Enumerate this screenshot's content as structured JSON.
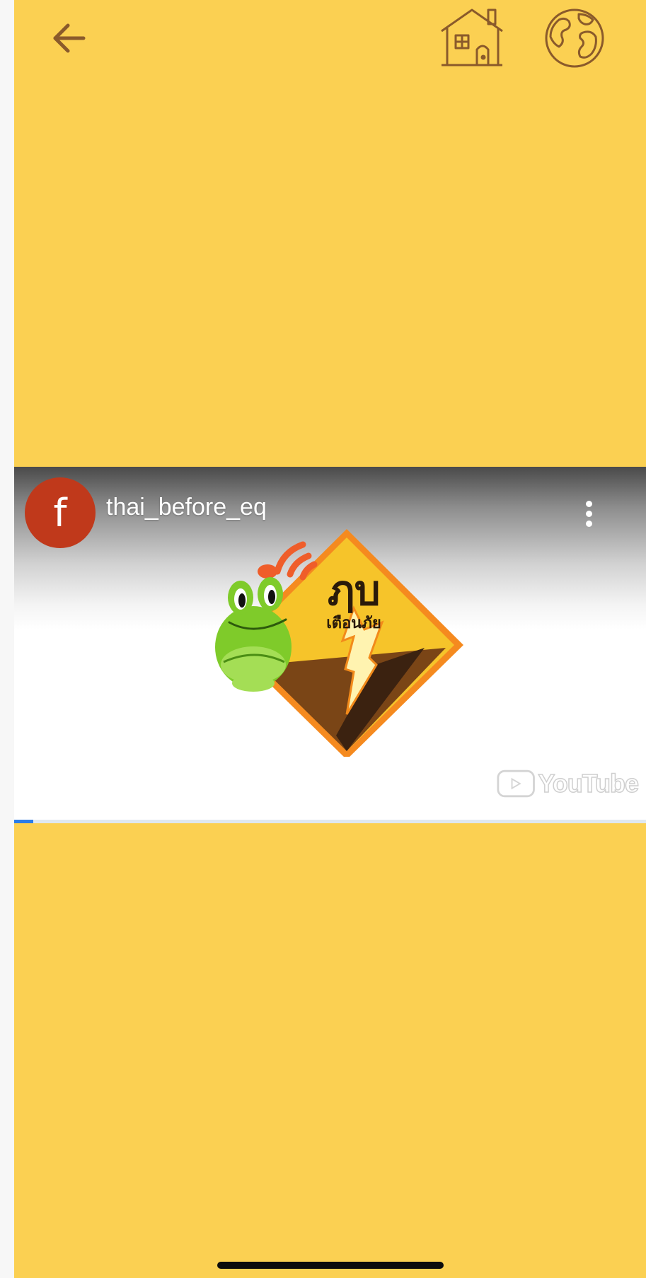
{
  "colors": {
    "background": "#fbd052",
    "icon_stroke": "#8a5a2b",
    "avatar": "#c0391b",
    "progress": "#2b7de9"
  },
  "header": {
    "back_icon": "arrow-left-icon",
    "home_icon": "house-icon",
    "globe_icon": "globe-icon"
  },
  "video": {
    "channel_avatar_letter": "f",
    "channel_name": "thai_before_eq",
    "logo_text_main": "ฦบ",
    "logo_text_sub": "เตือนภัย",
    "watermark": "YouTube",
    "progress_fraction": 0.03
  }
}
